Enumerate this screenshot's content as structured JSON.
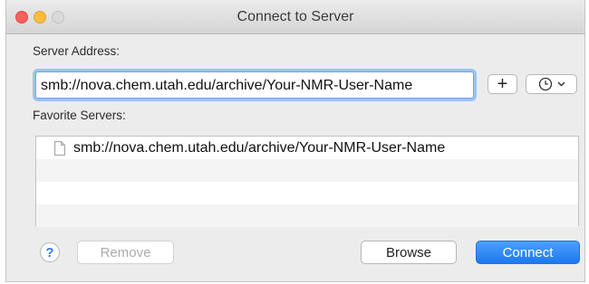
{
  "window": {
    "title": "Connect to Server"
  },
  "server_address": {
    "label": "Server Address:",
    "value": "smb://nova.chem.utah.edu/archive/Your-NMR-User-Name",
    "add_label": "+"
  },
  "favorites": {
    "label": "Favorite Servers:",
    "items": [
      {
        "label": "smb://nova.chem.utah.edu/archive/Your-NMR-User-Name",
        "icon": "document-icon"
      }
    ]
  },
  "footer": {
    "help_label": "?",
    "remove_label": "Remove",
    "browse_label": "Browse",
    "connect_label": "Connect"
  },
  "colors": {
    "accent": "#1b79f0",
    "focus_ring": "#9dc3f2",
    "close": "#fc605c",
    "minimize": "#fdbc40"
  }
}
